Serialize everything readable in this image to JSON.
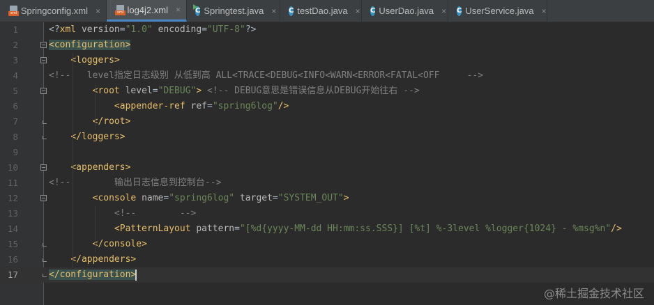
{
  "tabs": [
    {
      "label": "Springconfig.xml",
      "icon": "xml-file-icon",
      "active": false
    },
    {
      "label": "log4j2.xml",
      "icon": "xml-file-icon",
      "active": true
    },
    {
      "label": "Springtest.java",
      "icon": "java-class-runnable-icon",
      "active": false
    },
    {
      "label": "testDao.java",
      "icon": "java-class-icon",
      "active": false
    },
    {
      "label": "UserDao.java",
      "icon": "java-class-icon",
      "active": false
    },
    {
      "label": "UserService.java",
      "icon": "java-class-icon",
      "active": false
    }
  ],
  "close_glyph": "×",
  "editor": {
    "current_line": 17,
    "lines": [
      {
        "n": "1",
        "tokens": [
          [
            "p",
            "<?"
          ],
          [
            "t",
            "xml "
          ],
          [
            "a",
            "version"
          ],
          [
            "p",
            "="
          ],
          [
            "v",
            "\"1.0\""
          ],
          [
            "p",
            " "
          ],
          [
            "a",
            "encoding"
          ],
          [
            "p",
            "="
          ],
          [
            "v",
            "\"UTF-8\""
          ],
          [
            "p",
            "?>"
          ]
        ]
      },
      {
        "n": "2",
        "tokens": [
          [
            "hl",
            "<configuration>"
          ]
        ]
      },
      {
        "n": "3",
        "tokens": [
          [
            "p",
            "    "
          ],
          [
            "t",
            "<loggers>"
          ]
        ]
      },
      {
        "n": "4",
        "tokens": [
          [
            "c",
            "<!--   level指定日志级别 从低到高 ALL<TRACE<DEBUG<INFO<WARN<ERROR<FATAL<OFF     -->"
          ]
        ]
      },
      {
        "n": "5",
        "tokens": [
          [
            "p",
            "        "
          ],
          [
            "t",
            "<root "
          ],
          [
            "a",
            "level"
          ],
          [
            "p",
            "="
          ],
          [
            "v",
            "\"DEBUG\""
          ],
          [
            "t",
            ">"
          ],
          [
            "p",
            " "
          ],
          [
            "c",
            "<!-- DEBUG意思是错误信息从DEBUG开始往右 -->"
          ]
        ]
      },
      {
        "n": "6",
        "tokens": [
          [
            "p",
            "            "
          ],
          [
            "t",
            "<appender-ref "
          ],
          [
            "a",
            "ref"
          ],
          [
            "p",
            "="
          ],
          [
            "v",
            "\"spring6log\""
          ],
          [
            "t",
            "/>"
          ]
        ]
      },
      {
        "n": "7",
        "tokens": [
          [
            "p",
            "        "
          ],
          [
            "t",
            "</root>"
          ]
        ]
      },
      {
        "n": "8",
        "tokens": [
          [
            "p",
            "    "
          ],
          [
            "t",
            "</loggers>"
          ]
        ]
      },
      {
        "n": "9",
        "tokens": []
      },
      {
        "n": "10",
        "tokens": [
          [
            "p",
            "    "
          ],
          [
            "t",
            "<appenders>"
          ]
        ]
      },
      {
        "n": "11",
        "tokens": [
          [
            "c",
            "<!--        输出日志信息到控制台-->"
          ]
        ]
      },
      {
        "n": "12",
        "tokens": [
          [
            "p",
            "        "
          ],
          [
            "t",
            "<console "
          ],
          [
            "a",
            "name"
          ],
          [
            "p",
            "="
          ],
          [
            "v",
            "\"spring6log\""
          ],
          [
            "p",
            " "
          ],
          [
            "a",
            "target"
          ],
          [
            "p",
            "="
          ],
          [
            "v",
            "\"SYSTEM_OUT\""
          ],
          [
            "t",
            ">"
          ]
        ]
      },
      {
        "n": "13",
        "tokens": [
          [
            "p",
            "            "
          ],
          [
            "c",
            "<!--        -->"
          ]
        ]
      },
      {
        "n": "14",
        "tokens": [
          [
            "p",
            "            "
          ],
          [
            "t",
            "<PatternLayout "
          ],
          [
            "a",
            "pattern"
          ],
          [
            "p",
            "="
          ],
          [
            "v",
            "\"[%d{yyyy-MM-dd HH:mm:ss.SSS}] [%t] %-3level %logger{1024} - %msg%n\""
          ],
          [
            "t",
            "/>"
          ]
        ]
      },
      {
        "n": "15",
        "tokens": [
          [
            "p",
            "        "
          ],
          [
            "t",
            "</console>"
          ]
        ]
      },
      {
        "n": "16",
        "tokens": [
          [
            "p",
            "    "
          ],
          [
            "t",
            "</appenders>"
          ]
        ]
      },
      {
        "n": "17",
        "tokens": [
          [
            "hl",
            "</configuration>"
          ]
        ]
      }
    ]
  },
  "watermark": "@稀土掘金技术社区",
  "colors": {
    "background": "#2b2b2b",
    "tag": "#e8bf6a",
    "attribute": "#bababa",
    "string": "#6a8759",
    "comment": "#808080",
    "tab_active_underline": "#4a88c7"
  }
}
